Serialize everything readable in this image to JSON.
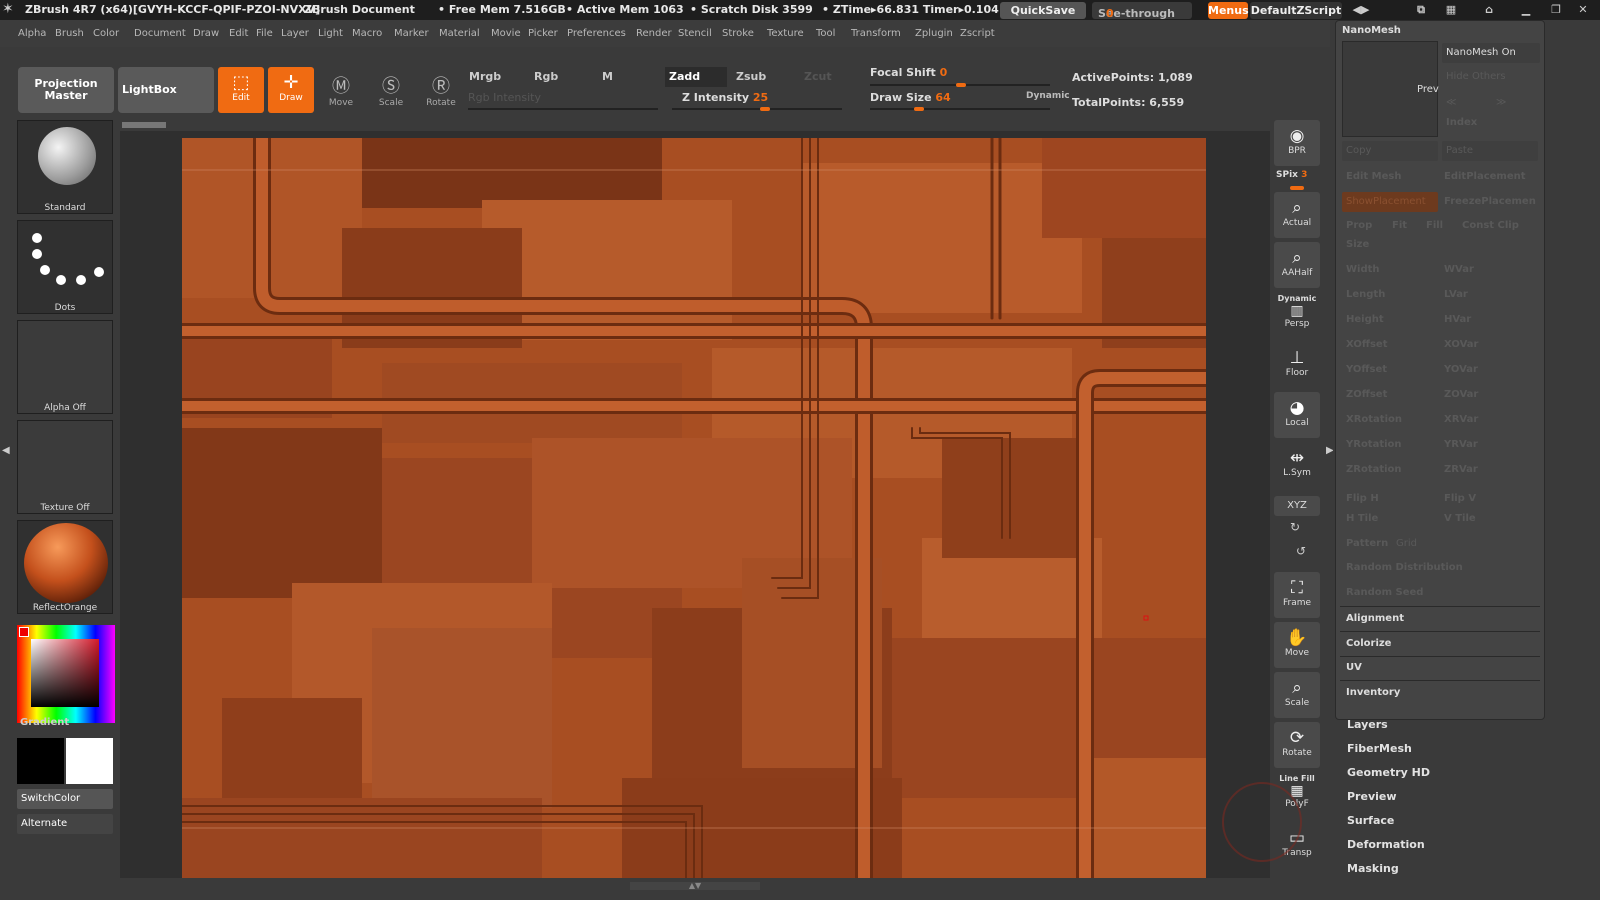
{
  "titlebar": {
    "app": "ZBrush 4R7 (x64)[GVYH-KCCF-QPIF-PZOI-NVXV]",
    "document": "ZBrush Document",
    "free_mem": "• Free Mem 7.516GB",
    "active_mem": "• Active Mem 1063",
    "scratch": "• Scratch Disk 3599",
    "ztime": "• ZTime▸66.831  Timer▸0.104",
    "quicksave": "QuickSave",
    "seethrough": "See-through",
    "seethrough_value": "0",
    "menus": "Menus",
    "script": "DefaultZScript"
  },
  "menubar": [
    "Alpha",
    "Brush",
    "Color",
    "Document",
    "Draw",
    "Edit",
    "File",
    "Layer",
    "Light",
    "Macro",
    "Marker",
    "Material",
    "Movie",
    "Picker",
    "Preferences",
    "Render",
    "Stencil",
    "Stroke",
    "Texture",
    "Tool",
    "Transform",
    "Zplugin",
    "Zscript"
  ],
  "toolbar": {
    "projection_master": "Projection Master",
    "lightbox": "LightBox",
    "edit": "Edit",
    "draw": "Draw",
    "move": "Move",
    "scale": "Scale",
    "rotate": "Rotate",
    "mrgb": "Mrgb",
    "rgb": "Rgb",
    "m": "M",
    "zadd": "Zadd",
    "zsub": "Zsub",
    "zcut": "Zcut",
    "rgb_intensity": "Rgb Intensity",
    "z_intensity_label": "Z Intensity",
    "z_intensity": "25",
    "focal_shift_label": "Focal Shift",
    "focal_shift": "0",
    "draw_size_label": "Draw Size",
    "draw_size": "64",
    "dynamic": "Dynamic",
    "active_points": "ActivePoints: 1,089",
    "total_points": "TotalPoints: 6,559"
  },
  "leftshelf": {
    "brush": "Standard",
    "stroke": "Dots",
    "alpha": "Alpha Off",
    "texture": "Texture Off",
    "material": "ReflectOrange",
    "gradient": "Gradient",
    "switchcolor": "SwitchColor",
    "alternate": "Alternate"
  },
  "rightshelf": {
    "bpr": "BPR",
    "spix_label": "SPix",
    "spix": "3",
    "actual": "Actual",
    "aahalf": "AAHalf",
    "dynamic": "Dynamic",
    "persp": "Persp",
    "floor": "Floor",
    "local": "Local",
    "lsym": "L.Sym",
    "xyz": "XYZ",
    "frame": "Frame",
    "move": "Move",
    "scale": "Scale",
    "rotate": "Rotate",
    "linefill": "Line Fill",
    "polyf": "PolyF",
    "transp": "Transp"
  },
  "rpanel": {
    "title": "NanoMesh",
    "prev": "Prev",
    "nanomesh_on": "NanoMesh On",
    "hide_others": "Hide Others",
    "index": "Index",
    "copy": "Copy",
    "paste": "Paste",
    "edit_mesh": "Edit Mesh",
    "edit_placement": "EditPlacement",
    "show_placement": "ShowPlacement",
    "freeze_placement": "FreezePlacemen",
    "prop": "Prop",
    "fit": "Fit",
    "fill": "Fill",
    "const_clip": "Const Clip",
    "size": "Size",
    "width": "Width",
    "wvar": "WVar",
    "length": "Length",
    "lvar": "LVar",
    "height": "Height",
    "hvar": "HVar",
    "xoffset": "XOffset",
    "xovar": "XOVar",
    "yoffset": "YOffset",
    "yovar": "YOVar",
    "zoffset": "ZOffset",
    "zovar": "ZOVar",
    "xrotation": "XRotation",
    "xrvar": "XRVar",
    "yrotation": "YRotation",
    "yrvar": "YRVar",
    "zrotation": "ZRotation",
    "zrvar": "ZRVar",
    "flip_h": "Flip H",
    "flip_v": "Flip V",
    "h_tile": "H Tile",
    "v_tile": "V Tile",
    "pattern": "Pattern",
    "grid": "Grid",
    "random_distribution": "Random Distribution",
    "random_seed": "Random Seed",
    "sections": [
      "Alignment",
      "Colorize",
      "UV",
      "Inventory"
    ],
    "tool_menu": [
      "Layers",
      "FiberMesh",
      "Geometry HD",
      "Preview",
      "Surface",
      "Deformation",
      "Masking"
    ]
  },
  "colors": {
    "accent": "#f06b12",
    "canvas_base": "#a84e22",
    "pipe": "#b85a2a"
  }
}
